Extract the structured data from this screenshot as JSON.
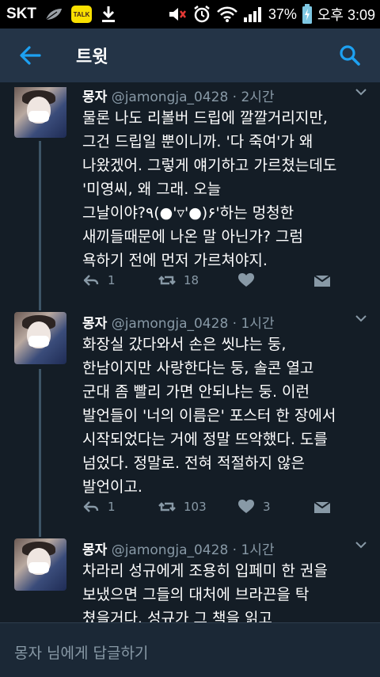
{
  "status_bar": {
    "carrier": "SKT",
    "talk_badge": "TALK",
    "battery": "37%",
    "time": "오후 3:09"
  },
  "header": {
    "title": "트윗"
  },
  "tweets": [
    {
      "name": "몽자",
      "handle": "@jamongja_0428",
      "time": "· 2시간",
      "text": "물론 나도 리볼버 드립에 깔깔거리지만,\n그건 드립일 뿐이니까. '다 죽여'가 왜\n나왔겠어. 그렇게 얘기하고 가르쳤는데도\n'미영씨, 왜 그래. 오늘\n그날이야?٩(●'▿'●)۶'하는 멍청한\n새끼들때문에 나온 말 아닌가? 그럼\n욕하기 전에 먼저 가르쳐야지.",
      "replies": "1",
      "retweets": "18",
      "likes": ""
    },
    {
      "name": "몽자",
      "handle": "@jamongja_0428",
      "time": "· 1시간",
      "text": "화장실 갔다와서 손은 씻냐는 둥,\n한남이지만 사랑한다는 둥, 솔콘 열고\n군대 좀 빨리 가면 안되냐는 둥. 이런\n발언들이 '너의 이름은' 포스터 한 장에서\n시작되었다는 거에 정말 뜨악했다. 도를\n넘었다. 정말로. 전혀 적절하지 않은\n발언이고.",
      "replies": "1",
      "retweets": "103",
      "likes": "3"
    },
    {
      "name": "몽자",
      "handle": "@jamongja_0428",
      "time": "· 1시간",
      "text": "차라리 성규에게 조용히 입페미 한 권을\n보냈으면 그들의 대처에 브라끈을 탁\n쳤을거다. 성규가 그 책을 읽고",
      "replies": "",
      "retweets": "",
      "likes": ""
    }
  ],
  "reply_bar": {
    "placeholder": "몽자 님에게 답글하기"
  },
  "colors": {
    "background": "#141d26",
    "app_bar": "#243447",
    "accent": "#1da1f2",
    "muted": "#8899a6"
  }
}
